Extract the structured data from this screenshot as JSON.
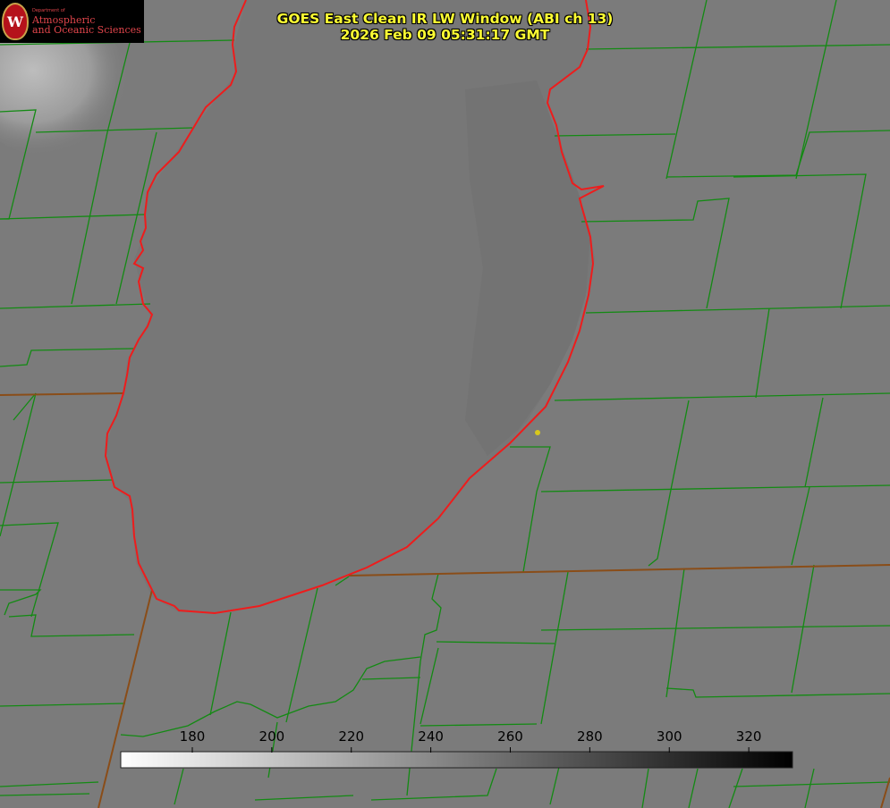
{
  "title": {
    "line1": "GOES East Clean IR LW Window (ABI ch 13)",
    "line2": "2026 Feb 09 05:31:17 GMT"
  },
  "logo": {
    "department": "Department of",
    "line1": "Atmospheric",
    "line2": "and Oceanic Sciences",
    "seal_letter": "W"
  },
  "colorbar": {
    "ticks": [
      "180",
      "200",
      "220",
      "240",
      "260",
      "280",
      "300",
      "320"
    ],
    "range": [
      162,
      331
    ],
    "gradient": "white to black"
  },
  "colors": {
    "background_gray": "#7b7b7b",
    "lake_gray": "#777777",
    "county_lines": "#138a13",
    "coastline": "#ee1c1c",
    "state_border": "#8a4d18",
    "title_text": "#ffff33",
    "marker": "#d8c81c"
  }
}
